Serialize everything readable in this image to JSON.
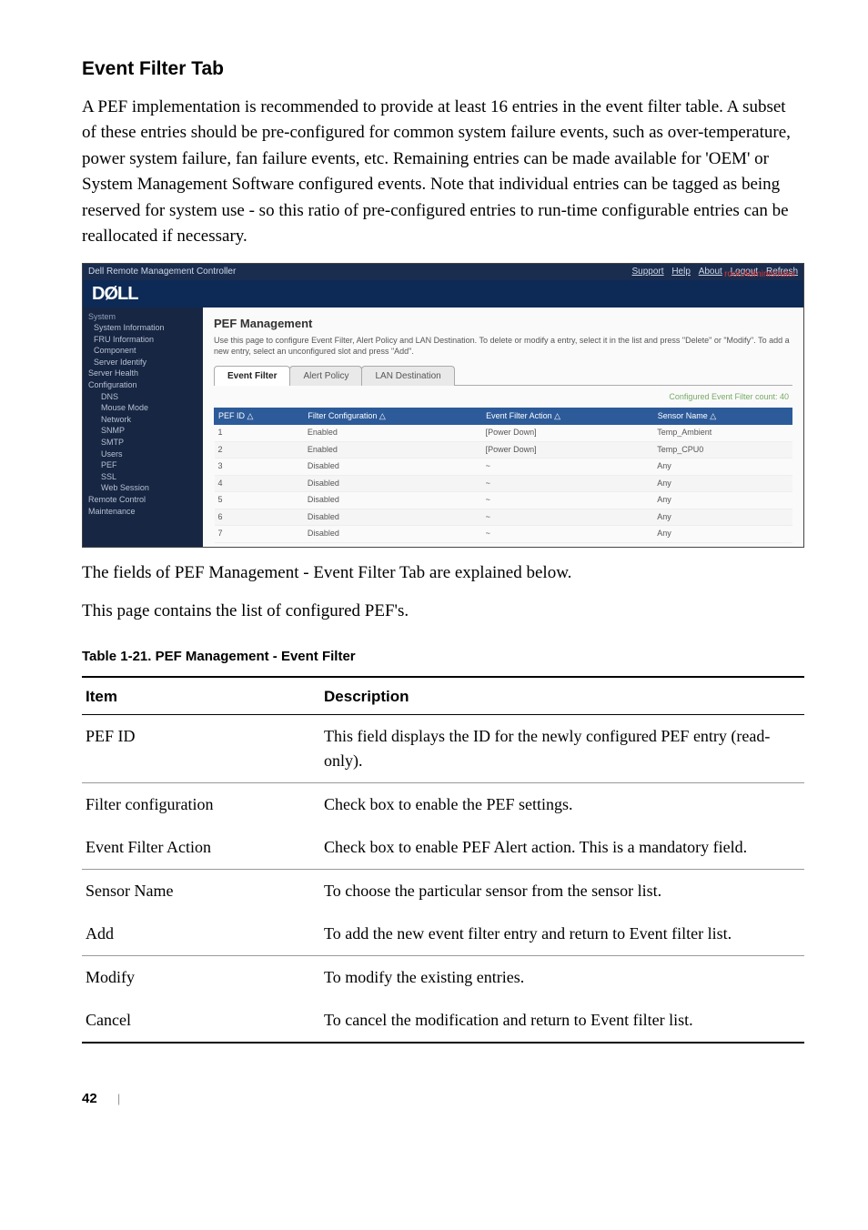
{
  "section_heading": "Event Filter Tab",
  "body_paragraph_1": "A PEF implementation is recommended to provide at least 16 entries in the event filter table. A subset  of  these  entries  should  be  pre-configured  for common  system  failure  events,  such  as over-temperature, power system failure, fan failure events, etc. Remaining entries can be made available  for 'OEM' or System  Management Software  configured events. Note that individual entries can be tagged as being reserved for system use - so this ratio of pre-configured entries to run-time configurable entries can be reallocated if necessary.",
  "body_paragraph_2": "The fields of PEF Management - Event Filter Tab are explained below.",
  "body_paragraph_3": "This page contains the list of configured PEF's.",
  "app": {
    "title": "Dell Remote Management Controller",
    "nav_links": [
      "Support",
      "Help",
      "About",
      "Logout",
      "Refresh"
    ],
    "root_user": "root:Administrator",
    "logo_text": "DØLL",
    "sidebar": {
      "top": "System",
      "items": [
        {
          "label": "System Information",
          "lvl": 1
        },
        {
          "label": "FRU Information",
          "lvl": 1
        },
        {
          "label": "Component",
          "lvl": 1
        },
        {
          "label": "Server Identify",
          "lvl": 1
        },
        {
          "label": "Server Health",
          "lvl": 0
        },
        {
          "label": "Configuration",
          "lvl": 0
        },
        {
          "label": "DNS",
          "lvl": 2
        },
        {
          "label": "Mouse Mode",
          "lvl": 2
        },
        {
          "label": "Network",
          "lvl": 2
        },
        {
          "label": "SNMP",
          "lvl": 2
        },
        {
          "label": "SMTP",
          "lvl": 2
        },
        {
          "label": "Users",
          "lvl": 2
        },
        {
          "label": "PEF",
          "lvl": 2
        },
        {
          "label": "SSL",
          "lvl": 2
        },
        {
          "label": "Web Session",
          "lvl": 2
        },
        {
          "label": "Remote Control",
          "lvl": 0
        },
        {
          "label": "Maintenance",
          "lvl": 0
        }
      ]
    },
    "panel": {
      "heading": "PEF Management",
      "description": "Use this page to configure Event Filter, Alert Policy and LAN Destination. To delete or modify a entry, select it in the list and press \"Delete\" or \"Modify\". To add a new entry, select an unconfigured slot and press \"Add\".",
      "tabs": [
        "Event Filter",
        "Alert Policy",
        "LAN Destination"
      ],
      "count_text": "Configured Event Filter count: 40",
      "columns": [
        "PEF ID  △",
        "Filter Configuration  △",
        "Event Filter Action  △",
        "Sensor Name  △"
      ],
      "rows": [
        {
          "id": "1",
          "cfg": "Enabled",
          "act": "[Power Down]",
          "sensor": "Temp_Ambient"
        },
        {
          "id": "2",
          "cfg": "Enabled",
          "act": "[Power Down]",
          "sensor": "Temp_CPU0"
        },
        {
          "id": "3",
          "cfg": "Disabled",
          "act": "~",
          "sensor": "Any"
        },
        {
          "id": "4",
          "cfg": "Disabled",
          "act": "~",
          "sensor": "Any"
        },
        {
          "id": "5",
          "cfg": "Disabled",
          "act": "~",
          "sensor": "Any"
        },
        {
          "id": "6",
          "cfg": "Disabled",
          "act": "~",
          "sensor": "Any"
        },
        {
          "id": "7",
          "cfg": "Disabled",
          "act": "~",
          "sensor": "Any"
        }
      ]
    }
  },
  "table_caption": "Table 1-21.    PEF Management - Event Filter",
  "table": {
    "head": {
      "c1": "Item",
      "c2": "Description"
    },
    "rows": [
      {
        "item": "PEF ID",
        "desc": "This field displays the ID for the newly configured PEF entry (read-only)."
      },
      {
        "item": "Filter configuration",
        "desc": "Check box to enable the PEF settings."
      },
      {
        "item": "Event Filter Action",
        "desc": "Check box to enable PEF Alert action. This is a mandatory field."
      },
      {
        "item": "Sensor Name",
        "desc": "To choose the particular sensor from the sensor list."
      },
      {
        "item": "Add",
        "desc": "To add the new event filter entry and return to Event filter list."
      },
      {
        "item": "Modify",
        "desc": "To modify the existing entries."
      },
      {
        "item": "Cancel",
        "desc": "To cancel the modification and return to Event filter list."
      }
    ]
  },
  "footer": {
    "page": "42",
    "divider": "|"
  }
}
